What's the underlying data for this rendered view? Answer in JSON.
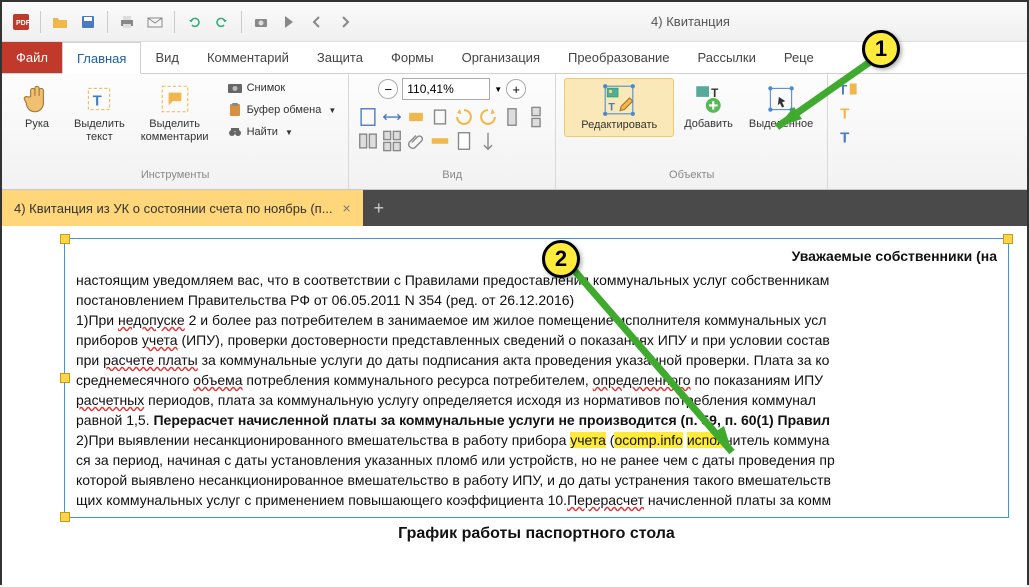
{
  "window_title": "4) Квитанция",
  "tabs": {
    "file": "Файл",
    "home": "Главная",
    "view": "Вид",
    "comment": "Комментарий",
    "protect": "Защита",
    "forms": "Формы",
    "organize": "Организация",
    "convert": "Преобразование",
    "mail": "Рассылки",
    "review": "Реце"
  },
  "ribbon": {
    "tools": {
      "hand": "Рука",
      "select_text": "Выделить\nтекст",
      "select_comments": "Выделить\nкомментарии",
      "snapshot": "Снимок",
      "clipboard": "Буфер обмена",
      "find": "Найти",
      "group_label": "Инструменты"
    },
    "view": {
      "zoom_value": "110,41%",
      "group_label": "Вид"
    },
    "objects": {
      "edit": "Редактировать",
      "add": "Добавить",
      "selected": "Выделенное",
      "group_label": "Объекты"
    }
  },
  "doctab": {
    "title": "4) Квитанция из УК о состоянии счета по ноябрь (п..."
  },
  "document": {
    "heading": "Уважаемые собственники (на",
    "p1a": "настоящим уведомляем вас, что в соответствии с Правилами предоставления коммунальных услуг собственникам",
    "p1b": "постановлением Правительства РФ от 06.05.2011 N 354 (ред. от 26.12.2016)",
    "p2a": "1)При ",
    "p2a_wavy": "недопуске",
    "p2b": " 2 и более раз потребителем в занимаемое им жилое помещение исполнителя коммунальных усл",
    "p3a": "приборов ",
    "p3a_wavy": "учета",
    "p3b": " (ИПУ), проверки достоверности представленных сведений о показаниях ИПУ и при условии состав",
    "p4a": "при ",
    "p4a_wavy": "расчете платы",
    "p4b": " за коммунальные услуги до даты подписания акта проведения указанной проверки. Плата за ко",
    "p5a": "среднемесячного ",
    "p5a_wavy": "объема",
    "p5b": " потребления коммунального ресурса потребителем, ",
    "p5b_wavy": "определенного",
    "p5c": " по показаниям ИПУ ",
    "p6a_wavy": "расчетных",
    "p6b": " периодов, плата за коммунальную услугу определяется исходя из нормативов потребления коммунал",
    "p7a": "равной 1,5. ",
    "p7b": "Перерасчет начисленной платы за коммунальные услуги не производится (п. 59, п. 60(1) Правил",
    "p8a": "2)При выявлении несанкционированного вмешательства в работу прибора ",
    "p8_hl1": "учета",
    "p8_mid": " (",
    "p8_hl2": "ocomp.info",
    "p8_mid2": " ",
    "p8_hl3": "испол",
    "p8b": "нитель коммуна",
    "p9": "ся за период, начиная с даты установления указанных пломб или устройств, но не ранее чем с даты проведения пр",
    "p10": "которой выявлено несанкционированное вмешательство в работу ИПУ, и до даты устранения такого вмешательств",
    "p11a": "щих коммунальных услуг с применением повышающего коэффициента 10.",
    "p11_wavy": "Перерасчет",
    "p11b": " начисленной платы за комм",
    "schedule": "График работы паспортного стола"
  },
  "annotations": {
    "b1": "1",
    "b2": "2"
  }
}
